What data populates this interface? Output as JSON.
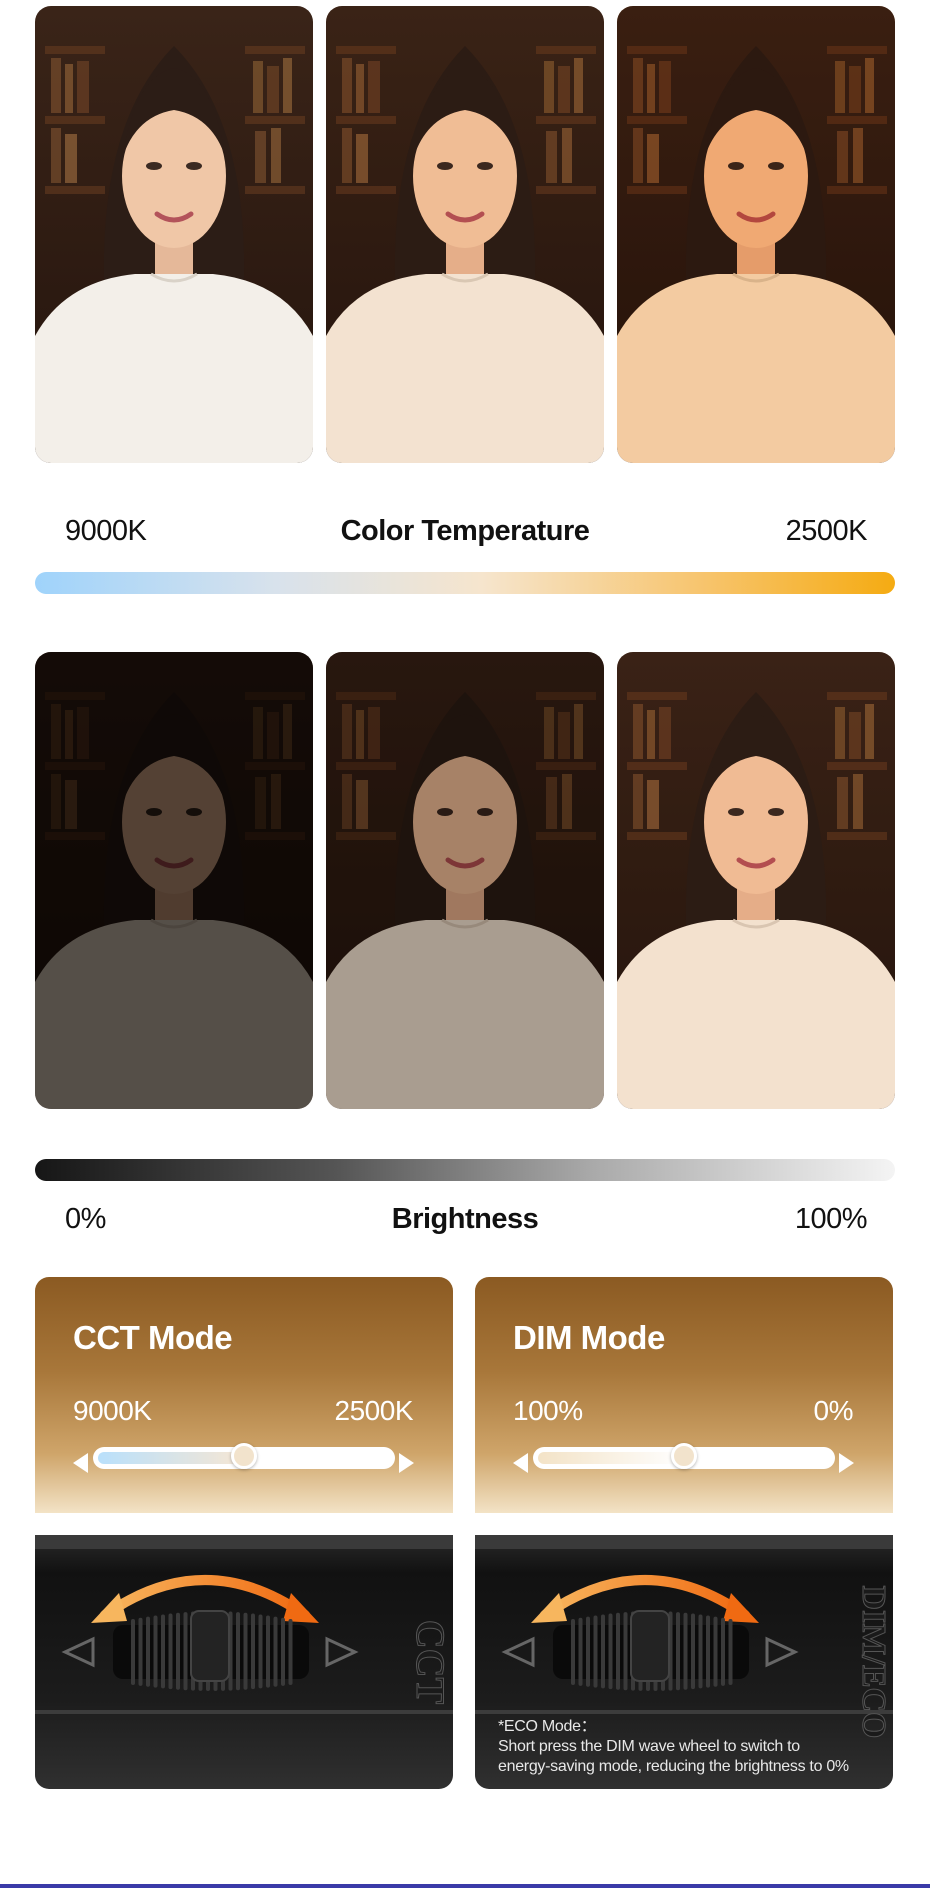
{
  "color_temperature": {
    "left_value": "9000K",
    "title": "Color Temperature",
    "right_value": "2500K"
  },
  "brightness": {
    "left_value": "0%",
    "title": "Brightness",
    "right_value": "100%"
  },
  "cct_mode": {
    "title": "CCT Mode",
    "left_value": "9000K",
    "right_value": "2500K",
    "slider_level": 0.5,
    "wheel_label": "CCT"
  },
  "dim_mode": {
    "title": "DIM Mode",
    "left_value": "100%",
    "right_value": "0%",
    "slider_level": 0.5,
    "wheel_label": "DIM/ECO",
    "eco_title": "*ECO Mode：",
    "eco_line1": "Short press the DIM wave wheel to switch to",
    "eco_line2": "energy-saving mode, reducing the brightness to 0%"
  },
  "colors": {
    "cool": "#9fd3fb",
    "warm": "#f5ab12",
    "card_brown": "#8b5a22",
    "device_black": "#1b1b1b",
    "arrow_orange": "#f07a1a"
  },
  "photos": {
    "row1_tints": [
      "#ffffff",
      "#fff2e4",
      "#ffd9b0"
    ],
    "row2_brightness": [
      0.35,
      0.7,
      1.0
    ]
  }
}
